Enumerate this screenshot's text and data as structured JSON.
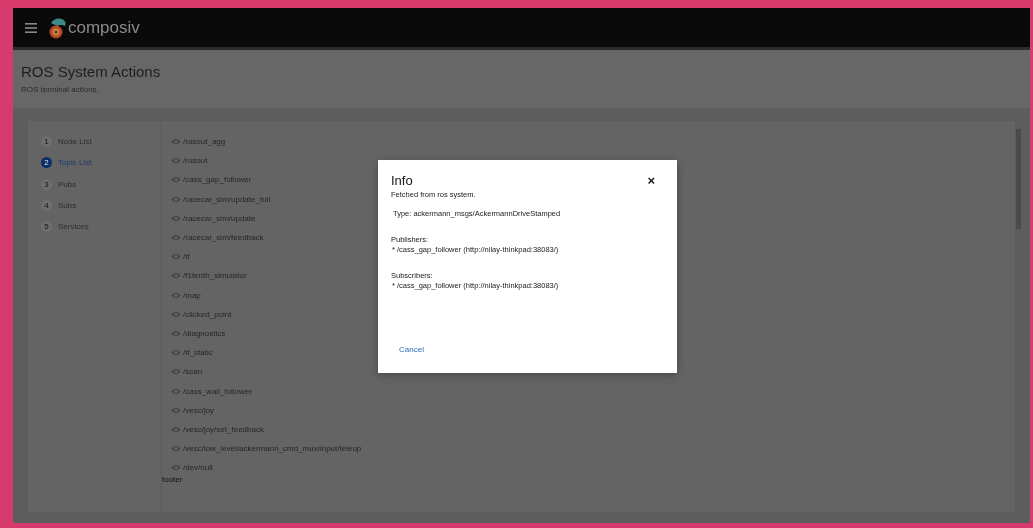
{
  "header": {
    "brand": "composiv"
  },
  "page": {
    "title": "ROS System Actions",
    "subtitle": "ROS terminal actions."
  },
  "steps": [
    {
      "number": "1",
      "label": "Node List",
      "selected": false
    },
    {
      "number": "2",
      "label": "Topic List",
      "selected": true
    },
    {
      "number": "3",
      "label": "Pubs",
      "selected": false
    },
    {
      "number": "4",
      "label": "Subs",
      "selected": false
    },
    {
      "number": "5",
      "label": "Services",
      "selected": false
    }
  ],
  "topics": [
    "/rosout_agg",
    "/rosout",
    "/cass_gap_follower",
    "/racecar_sim/update_full",
    "/racecar_sim/update",
    "/racecar_sim/feedback",
    "/tf",
    "/f1tenth_simulator",
    "/map",
    "/clicked_point",
    "/diagnostics",
    "/tf_static",
    "/scan",
    "/cass_wall_follower",
    "/vesc/joy",
    "/vesc/joy/set_feedback",
    "/vesc/low_level/ackermann_cmd_mux/input/teleop",
    "/dev/null"
  ],
  "footer": "footer",
  "modal": {
    "title": "Info",
    "description": "Fetched from ros system.",
    "type": "Type: ackermann_msgs/AckermannDriveStamped",
    "sections": [
      {
        "heading": "Publishers:",
        "line": "* /cass_gap_follower (http://nilay-thinkpad:38083/)"
      },
      {
        "heading": "Subscribers:",
        "line": "* /cass_gap_follower (http://nilay-thinkpad:38083/)"
      }
    ],
    "close": "×",
    "cancel": "Cancel"
  }
}
